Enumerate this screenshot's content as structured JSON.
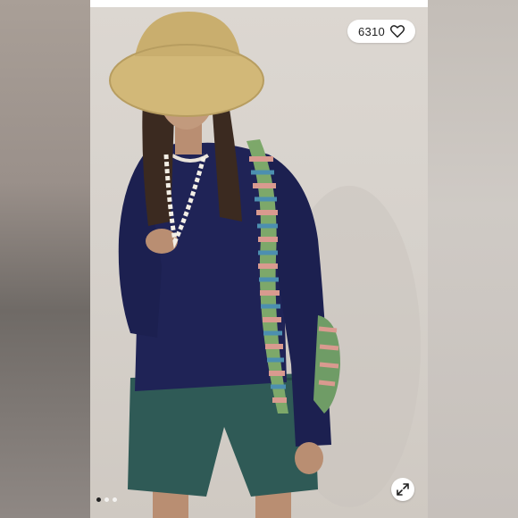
{
  "listing": {
    "like_count": "6310",
    "like_icon": "heart-outline-icon",
    "expand_icon": "expand-arrows-icon",
    "carousel": {
      "total": 3,
      "active_index": 0
    }
  },
  "colors": {
    "top_navy": "#1f2356",
    "shorts_teal": "#2f5a56",
    "hat_straw": "#d2b878",
    "background": "#d8d3cd"
  }
}
